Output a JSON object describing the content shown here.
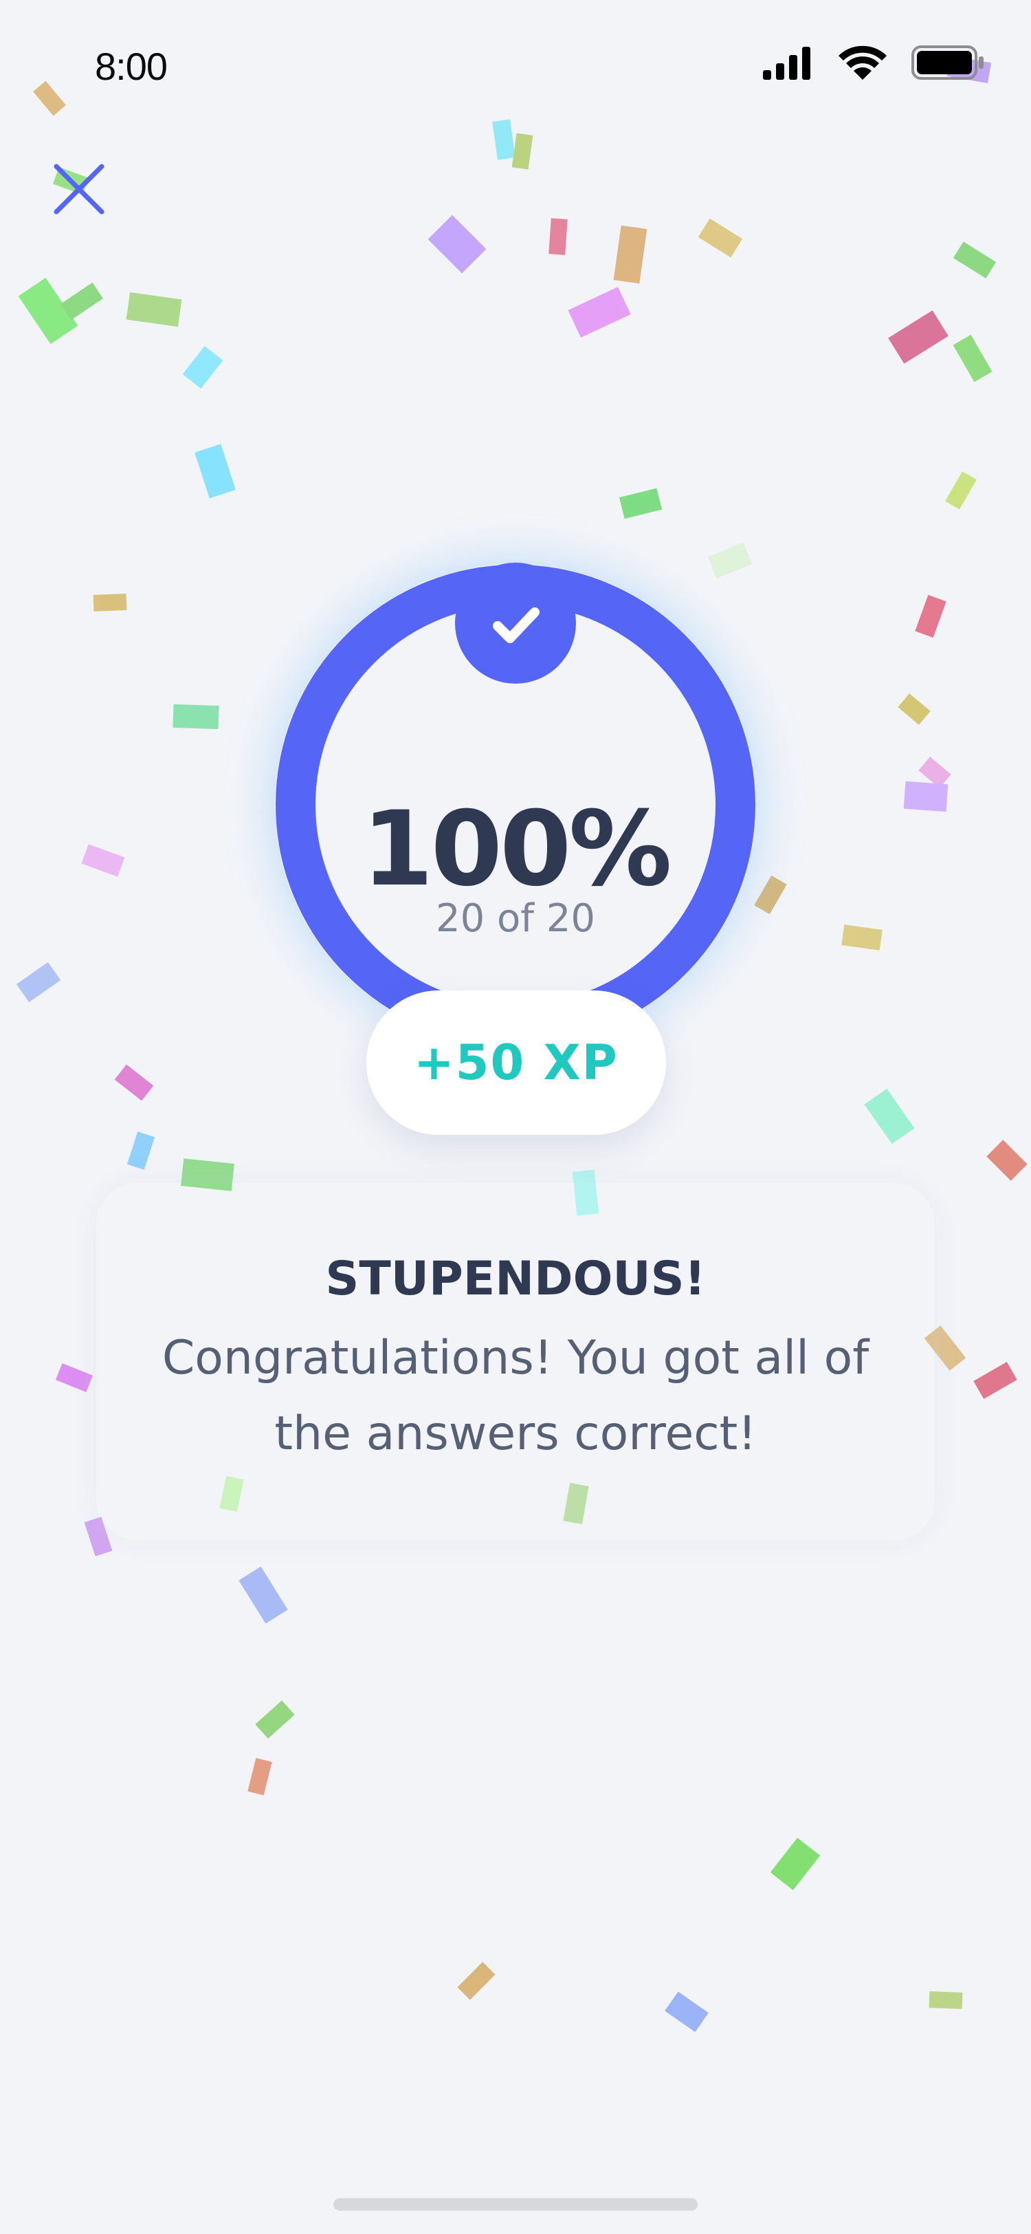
{
  "status_bar": {
    "time": "8:00",
    "icons": [
      "cellular-signal-icon",
      "wifi-icon",
      "battery-icon"
    ]
  },
  "close_button": {
    "icon": "close-icon",
    "color": "#5566f7"
  },
  "result": {
    "percent": "100%",
    "score": "20 of 20",
    "progress": 1.0,
    "badge_icon": "checkmark-icon",
    "xp": "+50 XP"
  },
  "message": {
    "headline": "STUPENDOUS!",
    "body": "Congratulations! You got all of the answers correct!"
  },
  "colors": {
    "background": "#f2f4f8",
    "ring": "#5566f7",
    "xp_text": "#1fc9c0",
    "headline": "#2f3a52",
    "body_text": "#566074"
  },
  "decorations": {
    "confetti_icon": "confetti-icon"
  }
}
